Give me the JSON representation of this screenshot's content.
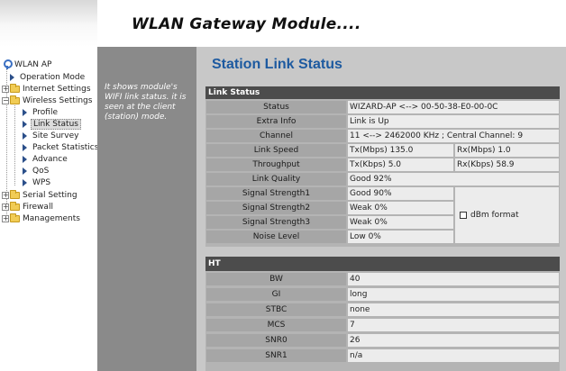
{
  "header": {
    "title": "WLAN Gateway Module...."
  },
  "sidebar": {
    "root": "WLAN AP",
    "items": [
      {
        "label": "Operation Mode"
      },
      {
        "label": "Internet Settings"
      },
      {
        "label": "Wireless Settings"
      },
      {
        "label": "Profile"
      },
      {
        "label": "Link Status"
      },
      {
        "label": "Site Survey"
      },
      {
        "label": "Packet Statistics"
      },
      {
        "label": "Advance"
      },
      {
        "label": "QoS"
      },
      {
        "label": "WPS"
      },
      {
        "label": "Serial Setting"
      },
      {
        "label": "Firewall"
      },
      {
        "label": "Managements"
      }
    ]
  },
  "description": "It shows module's WIFI link status. it is seen at the client (station) mode.",
  "main": {
    "title": "Station Link Status",
    "link_status": {
      "header": "Link Status",
      "status": {
        "label": "Status",
        "value": "WIZARD-AP <--> 00-50-38-E0-00-0C"
      },
      "extra_info": {
        "label": "Extra Info",
        "value": "Link is Up"
      },
      "channel": {
        "label": "Channel",
        "value": "11 <--> 2462000 KHz ; Central Channel: 9"
      },
      "link_speed": {
        "label": "Link Speed",
        "tx": "Tx(Mbps)  135.0",
        "rx": "Rx(Mbps)  1.0"
      },
      "throughput": {
        "label": "Throughput",
        "tx": "Tx(Kbps)  5.0",
        "rx": "Rx(Kbps)  58.9"
      },
      "link_quality": {
        "label": "Link Quality",
        "value": "Good    92%"
      },
      "signal1": {
        "label": "Signal Strength1",
        "value": "Good    90%"
      },
      "signal2": {
        "label": "Signal Strength2",
        "value": "Weak     0%"
      },
      "signal3": {
        "label": "Signal Strength3",
        "value": "Weak     0%"
      },
      "noise": {
        "label": "Noise Level",
        "value": "Low     0%"
      },
      "dbm_format": "dBm format"
    },
    "ht": {
      "header": "HT",
      "rows": [
        {
          "label": "BW",
          "value": "40"
        },
        {
          "label": "GI",
          "value": "long"
        },
        {
          "label": "STBC",
          "value": "none"
        },
        {
          "label": "MCS",
          "value": "7"
        },
        {
          "label": "SNR0",
          "value": "26"
        },
        {
          "label": "SNR1",
          "value": "n/a"
        }
      ]
    }
  }
}
